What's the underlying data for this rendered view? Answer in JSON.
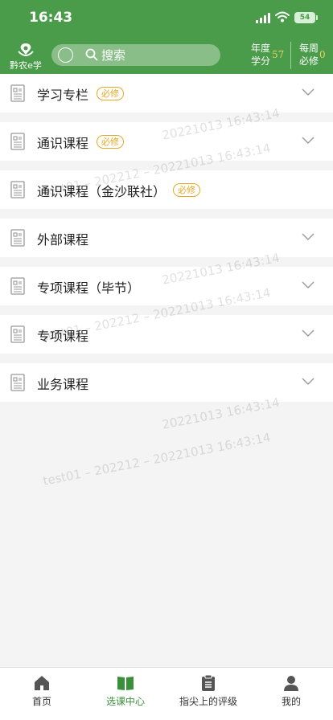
{
  "status_bar": {
    "time": "16:43",
    "battery": "54"
  },
  "header": {
    "logo_text": "黔农e学",
    "search_placeholder": "搜索",
    "yearly_label_1": "年度",
    "yearly_label_2": "学分",
    "yearly_value": "57",
    "weekly_label_1": "每周",
    "weekly_label_2": "必修",
    "weekly_value": "0"
  },
  "courses": [
    {
      "label": "学习专栏",
      "badge": "必修",
      "expandable": true
    },
    {
      "label": "通识课程",
      "badge": "必修",
      "expandable": true
    },
    {
      "label": "通识课程（金沙联社）",
      "badge": "必修",
      "expandable": false
    },
    {
      "label": "外部课程",
      "badge": "",
      "expandable": true
    },
    {
      "label": "专项课程（毕节）",
      "badge": "",
      "expandable": true
    },
    {
      "label": "专项课程",
      "badge": "",
      "expandable": true
    },
    {
      "label": "业务课程",
      "badge": "",
      "expandable": true
    }
  ],
  "watermark": {
    "stamp": "20221013 16:43:14",
    "user_line": "test01 – 202212 – 20221013 16:43:14"
  },
  "tabs": [
    {
      "label": "首页",
      "icon": "home-icon",
      "active": false
    },
    {
      "label": "选课中心",
      "icon": "book-icon",
      "active": true
    },
    {
      "label": "指尖上的评级",
      "icon": "clipboard-icon",
      "active": false
    },
    {
      "label": "我的",
      "icon": "person-icon",
      "active": false
    }
  ],
  "colors": {
    "header_green": "#4a9b4a",
    "badge_orange": "#e3a826",
    "active_tab_green": "#3a8f3a",
    "stat_value_yellow": "#f0d060"
  }
}
